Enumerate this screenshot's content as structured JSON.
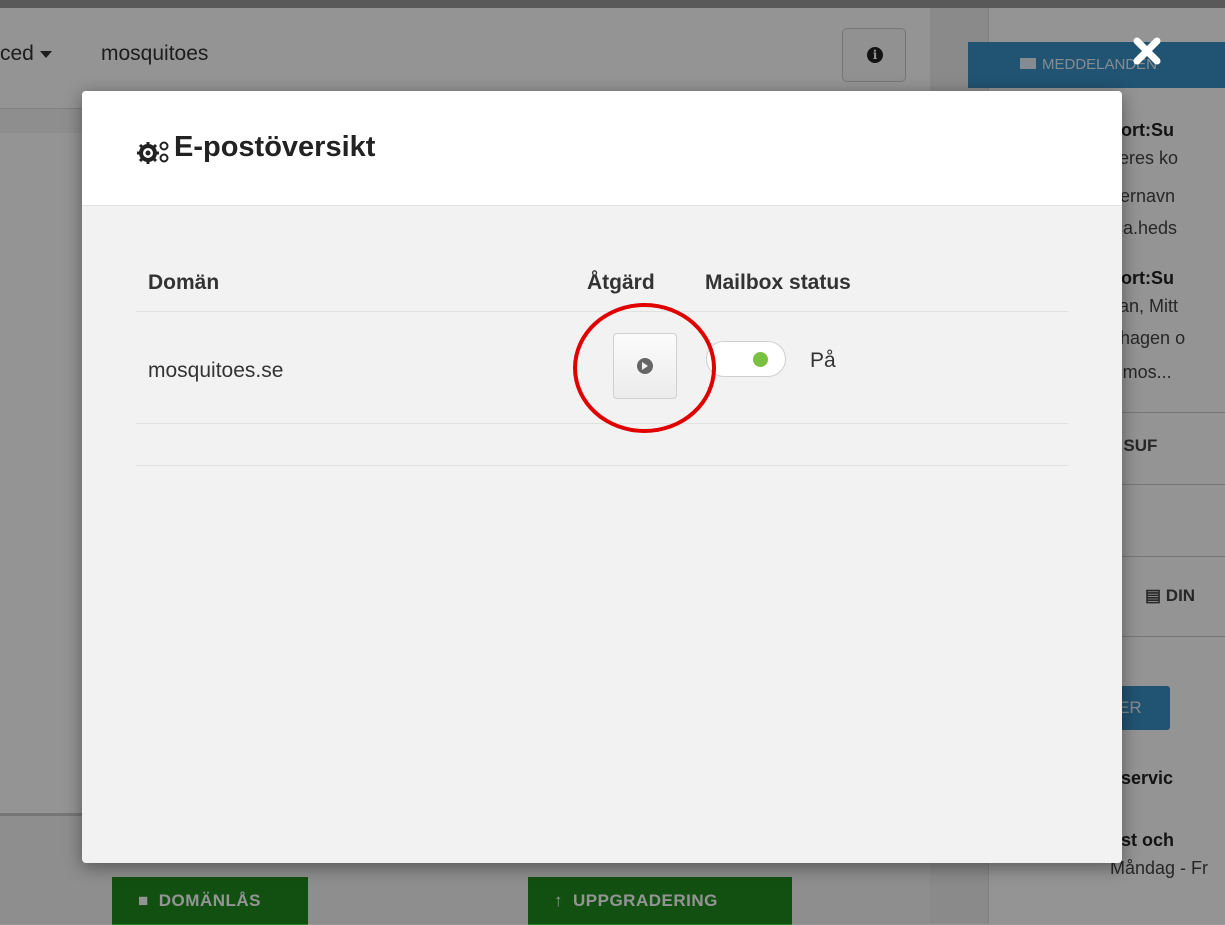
{
  "background": {
    "nav_advanced_label": "ced",
    "nav_site_label": "mosquitoes",
    "messages_tab_label": "MEDDELANDEN",
    "right_snippets": [
      {
        "text": "port:Su",
        "bold": true
      },
      {
        "text": "Jeres ko",
        "bold": false
      },
      {
        "text": "gernavn",
        "bold": false
      },
      {
        "text": "ica.heds",
        "bold": false
      },
      {
        "text": "port:Su",
        "bold": true
      },
      {
        "text": "san, Mitt",
        "bold": false
      },
      {
        "text": "dhagen o",
        "bold": false
      },
      {
        "text": "v.mos...",
        "bold": false
      }
    ],
    "support_label": "SUF",
    "din_label": "DIN",
    "er_button_label": "ER",
    "kundservice_label": "dservic",
    "post_label": "ost och",
    "hours_label": "Måndag - Fr",
    "domain_lock_button": "DOMÄNLÅS",
    "upgrade_button": "UPPGRADERING"
  },
  "modal": {
    "title": "E-postöversikt",
    "columns": {
      "domain": "Domän",
      "action": "Åtgärd",
      "mailbox_status": "Mailbox status"
    },
    "rows": [
      {
        "domain": "mosquitoes.se",
        "status_label": "På",
        "status_on": true
      }
    ]
  },
  "colors": {
    "accent_blue": "#3a8fc4",
    "button_green": "#1f8a1f",
    "toggle_on": "#7ac142",
    "highlight_red": "#e00000"
  }
}
